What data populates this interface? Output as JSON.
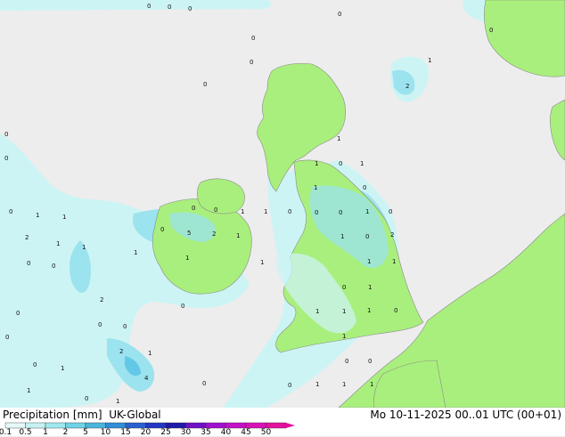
{
  "legend": {
    "title": "Precipitation [mm]",
    "model": "UK-Global",
    "datetime": "Mo 10-11-2025 00..01 UTC (00+01)",
    "levels": [
      {
        "label": "0.1",
        "color": "#e6f9f9"
      },
      {
        "label": "0.5",
        "color": "#c6f2f2"
      },
      {
        "label": "1",
        "color": "#9fe8ee"
      },
      {
        "label": "2",
        "color": "#6dd3e6"
      },
      {
        "label": "5",
        "color": "#4ab5dc"
      },
      {
        "label": "10",
        "color": "#2f8ed6"
      },
      {
        "label": "15",
        "color": "#2a5fd0"
      },
      {
        "label": "20",
        "color": "#2436c4"
      },
      {
        "label": "25",
        "color": "#1f1aa8"
      },
      {
        "label": "30",
        "color": "#6f10c8"
      },
      {
        "label": "35",
        "color": "#a010d0"
      },
      {
        "label": "40",
        "color": "#c510c8"
      },
      {
        "label": "45",
        "color": "#d810b8"
      },
      {
        "label": "50",
        "color": "#e4109c"
      }
    ]
  },
  "colors": {
    "sea": "#ededed",
    "land": "#a9ef7d",
    "rain_light": "#cdf4f4",
    "rain_mid": "#9be3ee",
    "rain_heavy": "#63c8e8",
    "border": "#8a8a8a"
  },
  "map_labels": [
    "0",
    "0",
    "0",
    "0",
    "0",
    "1",
    "0",
    "2",
    "0",
    "0",
    "1",
    "0",
    "1",
    "1",
    "0",
    "1",
    "0",
    "0",
    "0",
    "1",
    "1",
    "0",
    "0",
    "0",
    "1",
    "5",
    "2",
    "1",
    "1",
    "0",
    "1",
    "2",
    "1",
    "1",
    "1",
    "0",
    "0",
    "1",
    "1",
    "2",
    "1",
    "0",
    "0",
    "0",
    "1",
    "1",
    "1",
    "0",
    "1",
    "1",
    "0",
    "1",
    "0",
    "0",
    "0",
    "0",
    "2",
    "0",
    "0",
    "0",
    "1",
    "1",
    "2",
    "1",
    "4",
    "1",
    "1",
    "1",
    "1",
    "0",
    "0",
    "1",
    "0",
    "0",
    "0"
  ]
}
